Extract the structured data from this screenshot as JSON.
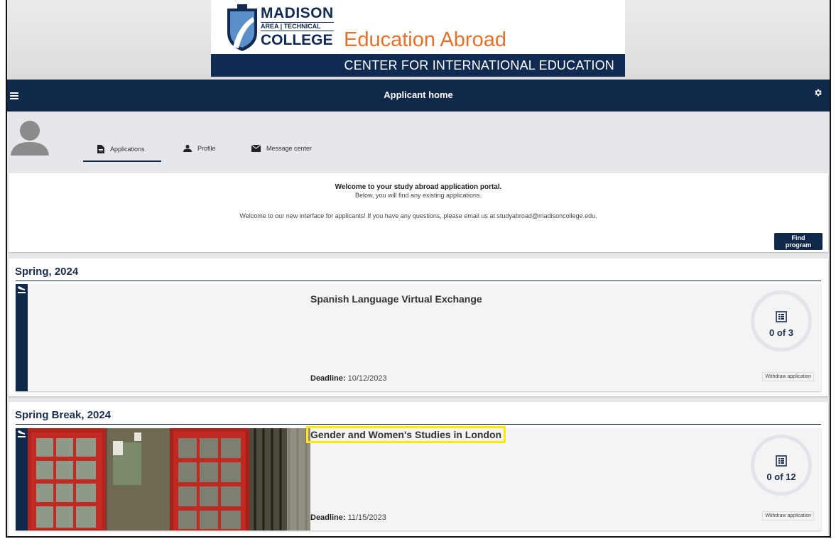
{
  "banner": {
    "brand_line1": "MADISON",
    "brand_line2": "AREA | TECHNICAL",
    "brand_line3": "COLLEGE",
    "program_title": "Education Abroad",
    "center_name": "CENTER FOR INTERNATIONAL EDUCATION"
  },
  "navbar": {
    "title": "Applicant home",
    "menu_icon": "hamburger-icon",
    "settings_icon": "gear-icon"
  },
  "tabs": [
    {
      "label": "Applications",
      "icon": "document-icon",
      "active": true
    },
    {
      "label": "Profile",
      "icon": "person-icon",
      "active": false
    },
    {
      "label": "Message center",
      "icon": "envelope-icon",
      "active": false
    }
  ],
  "welcome": {
    "heading": "Welcome to your study abroad application portal.",
    "subheading": "Below, you will find any existing applications.",
    "note": "Welcome to our new interface for applicants! If you have any questions, please email us at studyabroad@madisoncollege.edu.",
    "find_button": "Find program"
  },
  "sections": [
    {
      "term": "Spring, 2024",
      "application": {
        "title": "Spanish Language Virtual Exchange",
        "deadline_label": "Deadline:",
        "deadline": "10/12/2023",
        "progress": "0 of 3",
        "withdraw_label": "Withdraw application"
      }
    },
    {
      "term": "Spring Break, 2024",
      "application": {
        "title": "Gender and Women's Studies in London",
        "deadline_label": "Deadline:",
        "deadline": "11/15/2023",
        "progress": "0 of 12",
        "withdraw_label": "Withdraw application"
      }
    }
  ],
  "colors": {
    "navy": "#10284a",
    "orange": "#e3712b",
    "highlight": "#ffea00"
  }
}
